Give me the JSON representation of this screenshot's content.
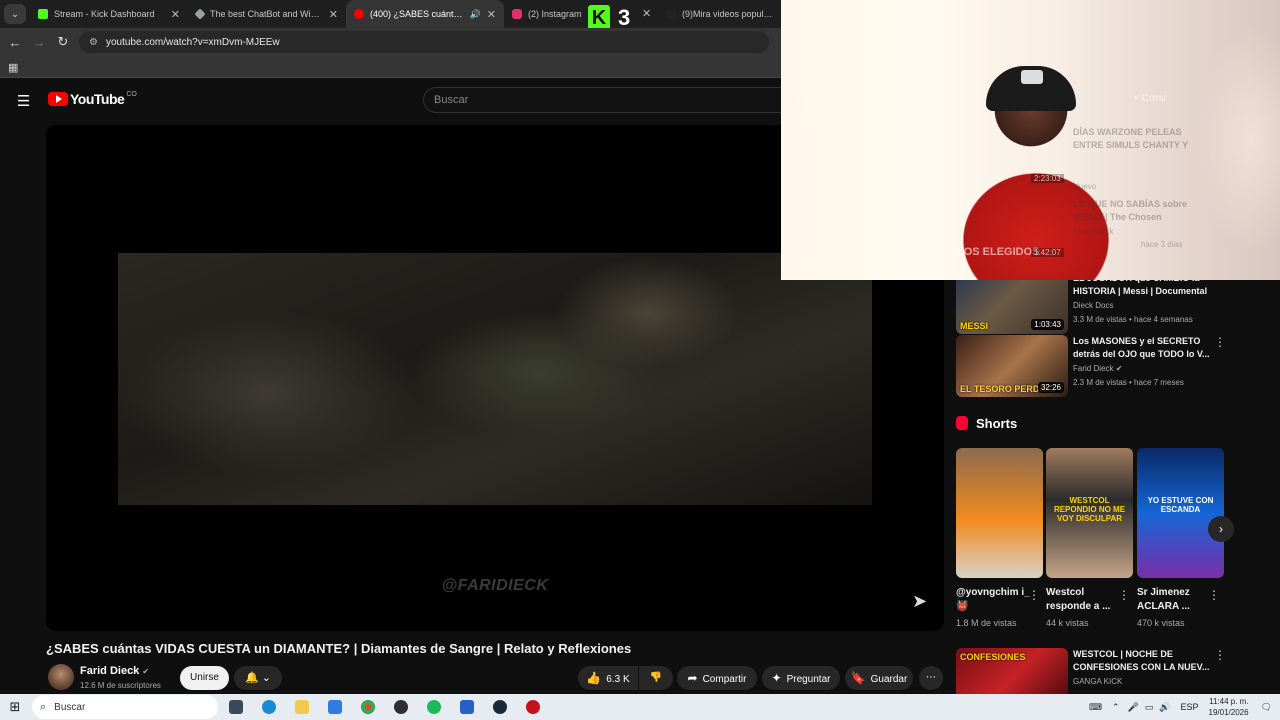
{
  "browser": {
    "tabs": [
      {
        "title": "Stream - Kick Dashboard",
        "color": "#53fc18"
      },
      {
        "title": "The best ChatBot and Widgets",
        "color": "#9aa0a6"
      },
      {
        "title": "(400) ¿SABES cuántas VIDAS",
        "color": "#ff0000"
      },
      {
        "title": "(2) Instagram",
        "color": "#e1306c"
      },
      {
        "title": "(9)Mira videos populares sel",
        "color": "#222222"
      }
    ],
    "url": "youtube.com/watch?v=xmDvm-MJEEw"
  },
  "stream_overlay": {
    "kick_letter": "K",
    "number": "3"
  },
  "youtube": {
    "logo_text": "YouTube",
    "logo_country": "CO",
    "search_placeholder": "Buscar",
    "create_label": "Crear",
    "watermark": "@FARIDIECK",
    "video_title": "¿SABES cuántas VIDAS CUESTA un DIAMANTE? | Diamantes de Sangre | Relato y Reflexiones",
    "channel": {
      "name": "Farid Dieck",
      "subscribers": "12.6 M de suscriptores"
    },
    "buttons": {
      "join": "Unirse",
      "likes": "6.3 K",
      "share": "Compartir",
      "ask": "Preguntar",
      "save": "Guardar"
    }
  },
  "recommendations": [
    {
      "title": "DÍAS WARZONE PELEAS ENTRE SIMULS CHANTY Y",
      "channel": "",
      "meta": "Nuevo",
      "duration": "2:23:03"
    },
    {
      "title": "LO QUE NO SABÍAS sobre JESÚS | The Chosen",
      "channel": "Farid Dieck",
      "meta": "hace 3 días",
      "duration": "1:42:07",
      "thumb_caption": "LOS ELEGIDOS"
    },
    {
      "title": "EL JUGADOR que CAMBIÓ la HISTORIA | Messi | Documental",
      "channel": "Dieck Docs",
      "meta": "3.3 M de vistas • hace 4 semanas",
      "duration": "1:03:43",
      "thumb_caption": "MESSI"
    },
    {
      "title": "Los MASONES y el SECRETO detrás del OJO que TODO lo V...",
      "channel": "Farid Dieck",
      "meta": "2.3 M de vistas • hace 7 meses",
      "duration": "32:26",
      "thumb_caption": "EL TESORO PERDIDO"
    },
    {
      "title": "WESTCOL | NOCHE DE CONFESIONES CON LA NUEV...",
      "channel": "GANGA KICK",
      "meta": "",
      "duration": "",
      "thumb_caption": "CONFESIONES"
    }
  ],
  "shorts": {
    "heading": "Shorts",
    "items": [
      {
        "title": "@yovngchim i_ 👹",
        "views": "1.8 M de vistas",
        "caption": ""
      },
      {
        "title": "Westcol responde a ...",
        "views": "44 k vistas",
        "caption": "WESTCOL REPONDIO NO ME VOY DISCULPAR"
      },
      {
        "title": "Sr Jimenez ACLARA ...",
        "views": "470 k vistas",
        "caption": "YO ESTUVE CON ESCANDA"
      }
    ]
  },
  "taskbar": {
    "search_placeholder": "Buscar",
    "lang": "ESP",
    "time": "11:44 p. m.",
    "date": "19/01/2026"
  }
}
